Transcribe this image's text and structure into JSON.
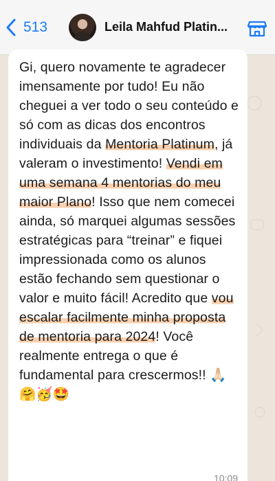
{
  "header": {
    "back_count": "513",
    "contact_name": "Leila Mahfud Platin..."
  },
  "message": {
    "parts": [
      {
        "text": "Gi, quero novamente te agradecer imensamente por tudo! Eu não cheguei a ver todo o seu conteúdo e só com as dicas dos encontros individuais da ",
        "highlight": false
      },
      {
        "text": "Mentoria Platinum",
        "highlight": true
      },
      {
        "text": ", já valeram o investimento! ",
        "highlight": false
      },
      {
        "text": "Vendi em uma semana 4 mentorias do meu maior Plano",
        "highlight": true
      },
      {
        "text": "! Isso que nem comecei ainda, só marquei algumas sessões estratégicas para “treinar” e fiquei impressionada como os alunos estão fechando sem questionar o valor e muito fácil! Acredito que ",
        "highlight": false
      },
      {
        "text": "vou escalar facilmente minha proposta de mentoria para 2024",
        "highlight": true
      },
      {
        "text": "! Você realmente entrega o que é fundamental para crescermos!! 🙏🏻🤗🥳🤩",
        "highlight": false
      }
    ],
    "time": "10:09"
  },
  "colors": {
    "accent": "#1b7cf5",
    "highlight": "#f4aa6e",
    "chat_background": "#ece5dc"
  }
}
